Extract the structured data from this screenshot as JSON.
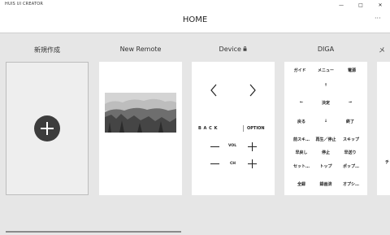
{
  "window": {
    "title": "HUIS UI CREATOR",
    "minimize": "—",
    "maximize": "□",
    "close": "✕"
  },
  "header": {
    "title": "HOME",
    "more": "···"
  },
  "cards": {
    "new": {
      "label": "新規作成"
    },
    "remote": {
      "label": "New Remote"
    },
    "device": {
      "label": "Device",
      "lock": "🔒",
      "left_arrow": "‹",
      "right_arrow": "›",
      "back": "B A C K",
      "option": "OPTION",
      "vol": "VOL",
      "ch": "CH"
    },
    "diga": {
      "label": "DIGA",
      "buttons": [
        [
          "ガイド",
          "メニュー",
          "電源"
        ],
        [
          "",
          "↑",
          ""
        ],
        [
          "←",
          "決定",
          "→"
        ],
        [
          "戻る",
          "↓",
          "終了"
        ],
        [
          "前スキ…",
          "再生／停止",
          "スキップ"
        ],
        [
          "早戻し",
          "停止",
          "早送り"
        ],
        [
          "セット…",
          "トップ",
          "ポップ…"
        ],
        [
          "全録",
          "録画済",
          "オプシ…"
        ]
      ]
    },
    "partial": {
      "label_char": "メ",
      "row_char": "チ"
    }
  }
}
